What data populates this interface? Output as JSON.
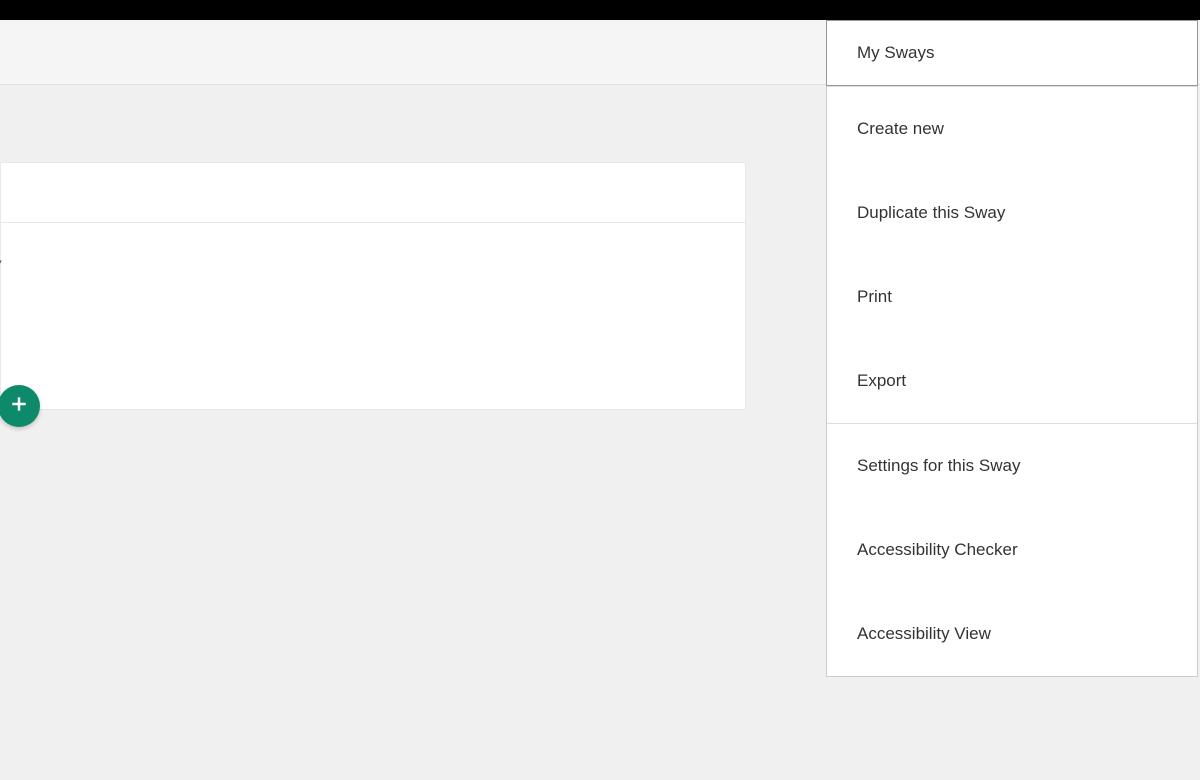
{
  "title_card": {
    "title_text": "y"
  },
  "add_button": {
    "icon_name": "plus-icon"
  },
  "menu": {
    "sections": [
      {
        "items": [
          {
            "label": "My Sways"
          }
        ]
      },
      {
        "items": [
          {
            "label": "Create new"
          },
          {
            "label": "Duplicate this Sway"
          },
          {
            "label": "Print"
          },
          {
            "label": "Export"
          }
        ]
      },
      {
        "items": [
          {
            "label": "Settings for this Sway"
          },
          {
            "label": "Accessibility Checker"
          },
          {
            "label": "Accessibility View"
          }
        ]
      }
    ]
  }
}
